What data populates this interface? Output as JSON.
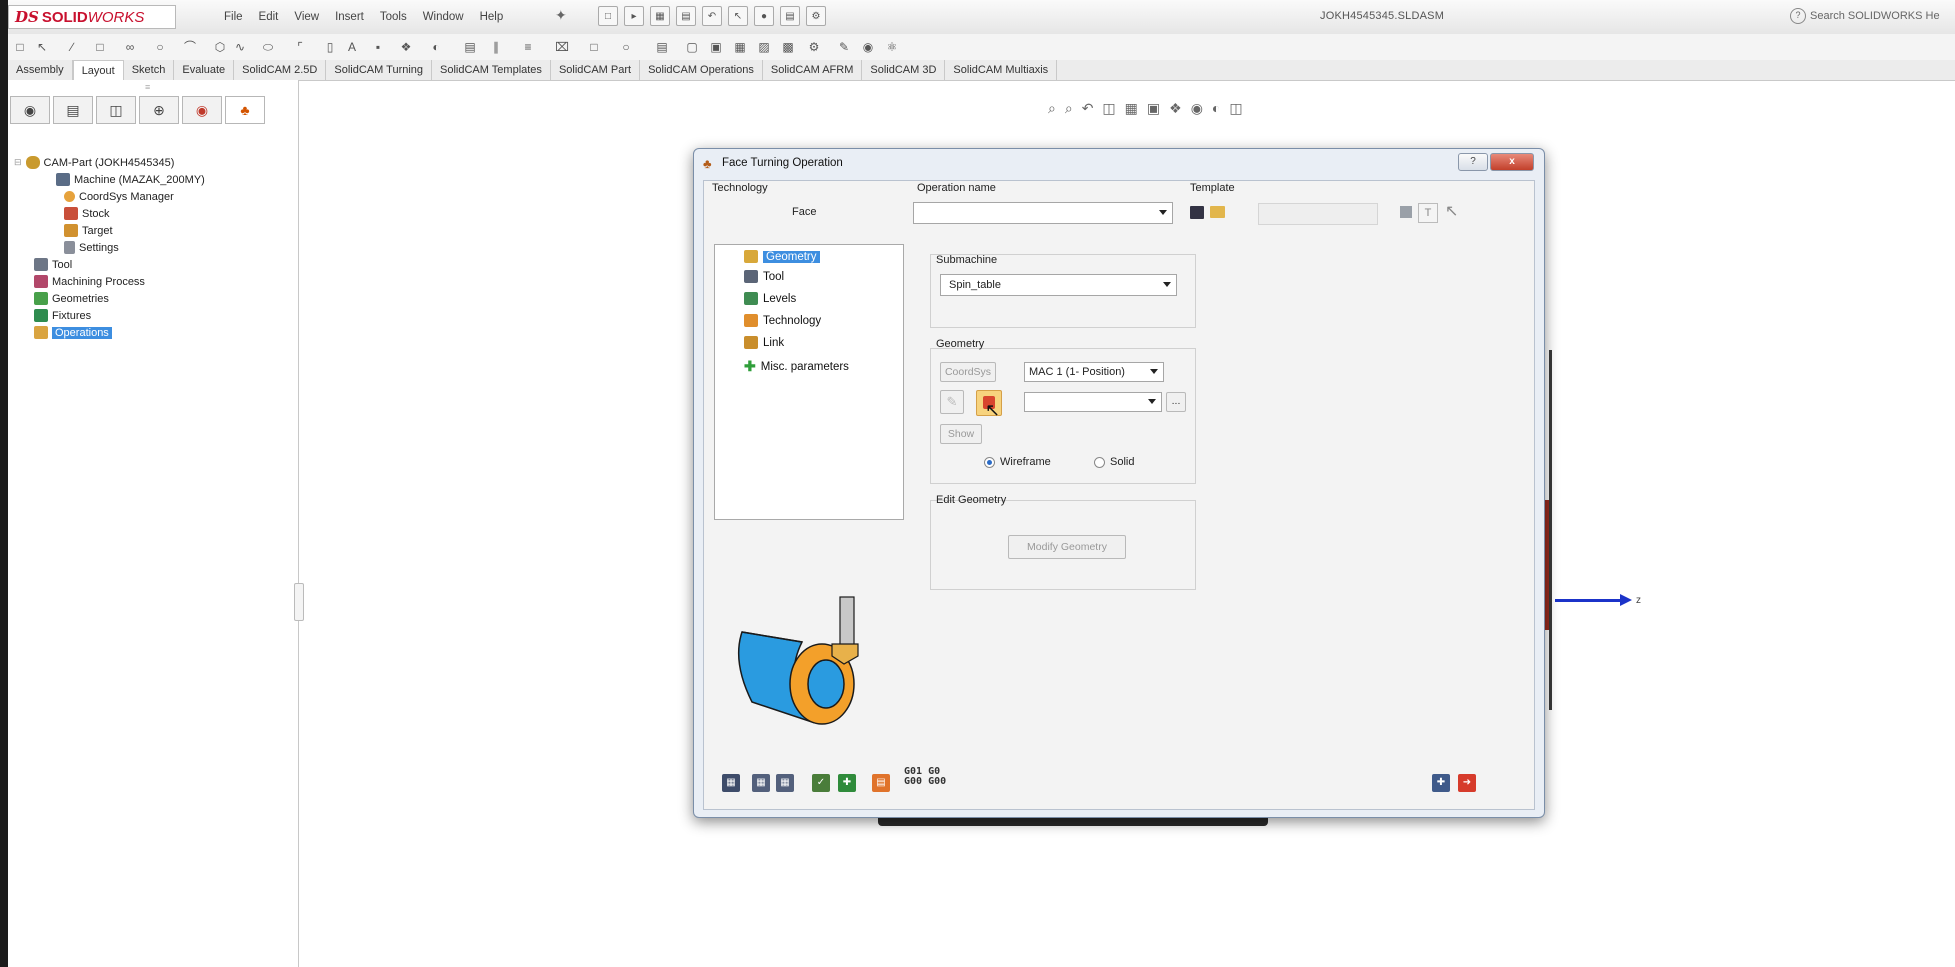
{
  "app": {
    "brand_prefix": "SOLID",
    "brand_suffix": "WORKS",
    "ds_mark": "DS",
    "document_title": "JOKH4545345.SLDASM",
    "search_placeholder": "Search SOLIDWORKS He"
  },
  "menu": [
    "File",
    "Edit",
    "View",
    "Insert",
    "Tools",
    "Window",
    "Help"
  ],
  "tabs": [
    {
      "label": "Assembly",
      "active": false
    },
    {
      "label": "Layout",
      "active": true
    },
    {
      "label": "Sketch",
      "active": false
    },
    {
      "label": "Evaluate",
      "active": false
    },
    {
      "label": "SolidCAM 2.5D",
      "active": false
    },
    {
      "label": "SolidCAM Turning",
      "active": false
    },
    {
      "label": "SolidCAM Templates",
      "active": false
    },
    {
      "label": "SolidCAM Part",
      "active": false
    },
    {
      "label": "SolidCAM Operations",
      "active": false
    },
    {
      "label": "SolidCAM AFRM",
      "active": false
    },
    {
      "label": "SolidCAM 3D",
      "active": false
    },
    {
      "label": "SolidCAM Multiaxis",
      "active": false
    }
  ],
  "feature_tree": {
    "root": "CAM-Part (JOKH4545345)",
    "machine": "Machine (MAZAK_200MY)",
    "coordsys": "CoordSys Manager",
    "stock": "Stock",
    "target": "Target",
    "settings": "Settings",
    "tool": "Tool",
    "machining_process": "Machining Process",
    "geometries": "Geometries",
    "fixtures": "Fixtures",
    "operations": "Operations",
    "selected": "Operations"
  },
  "dialog": {
    "title": "Face Turning Operation",
    "help_btn": "?",
    "close_btn": "x",
    "technology_label": "Technology",
    "technology_value": "Face",
    "operation_name_label": "Operation name",
    "operation_name_value": "",
    "template_label": "Template",
    "nav": [
      "Geometry",
      "Tool",
      "Levels",
      "Technology",
      "Link",
      "Misc. parameters"
    ],
    "nav_selected": "Geometry",
    "submachine_label": "Submachine",
    "submachine_value": "Spin_table",
    "geometry_label": "Geometry",
    "coordsys_btn": "CoordSys",
    "coordsys_value": "MAC 1 (1- Position)",
    "geometry_value": "",
    "browse_btn": "...",
    "show_btn": "Show",
    "wireframe_label": "Wireframe",
    "solid_label": "Solid",
    "view_mode": "Wireframe",
    "edit_geometry_label": "Edit Geometry",
    "modify_geometry_btn": "Modify Geometry",
    "gcode_1": "G01 G0",
    "gcode_2": "G00 G00"
  },
  "axis_label": "z",
  "colors": {
    "brand_red": "#c8102e",
    "selection_blue": "#3d8ee0",
    "axis_blue": "#1b33c9",
    "part_blue": "#2a9be0",
    "part_orange": "#f3a02a"
  }
}
